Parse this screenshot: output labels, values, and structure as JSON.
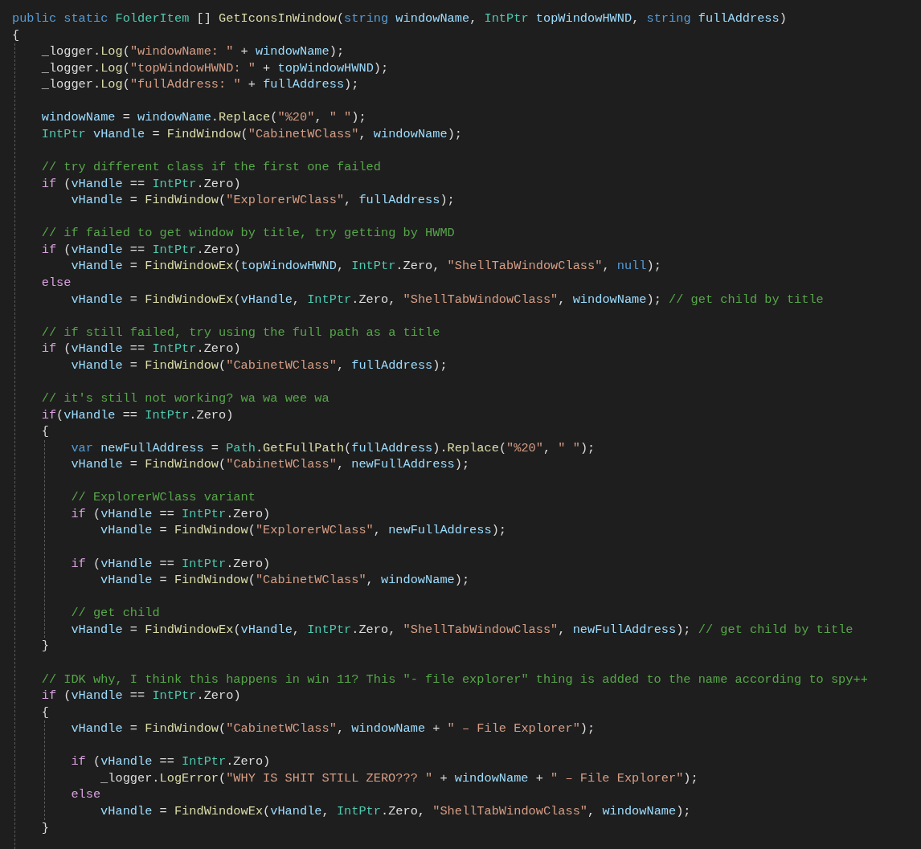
{
  "code": [
    {
      "kind": "line",
      "tokens": [
        {
          "kind": "kw",
          "text": "public static "
        },
        {
          "kind": "type",
          "text": "FolderItem"
        },
        {
          "kind": "p",
          "text": " [] "
        },
        {
          "kind": "fn",
          "text": "GetIconsInWindow"
        },
        {
          "kind": "p",
          "text": "("
        },
        {
          "kind": "kw",
          "text": "string "
        },
        {
          "kind": "var",
          "text": "windowName"
        },
        {
          "kind": "p",
          "text": ", "
        },
        {
          "kind": "type",
          "text": "IntPtr "
        },
        {
          "kind": "var",
          "text": "topWindowHWND"
        },
        {
          "kind": "p",
          "text": ", "
        },
        {
          "kind": "kw",
          "text": "string "
        },
        {
          "kind": "var",
          "text": "fullAddress"
        },
        {
          "kind": "p",
          "text": ")"
        }
      ]
    },
    {
      "kind": "line",
      "tokens": [
        {
          "kind": "p",
          "text": "{"
        }
      ]
    },
    {
      "kind": "block",
      "children": [
        {
          "kind": "line",
          "tokens": [
            {
              "kind": "p",
              "text": "_logger."
            },
            {
              "kind": "fn",
              "text": "Log"
            },
            {
              "kind": "p",
              "text": "("
            },
            {
              "kind": "str",
              "text": "\"windowName: \""
            },
            {
              "kind": "p",
              "text": " + "
            },
            {
              "kind": "var",
              "text": "windowName"
            },
            {
              "kind": "p",
              "text": ");"
            }
          ]
        },
        {
          "kind": "line",
          "tokens": [
            {
              "kind": "p",
              "text": "_logger."
            },
            {
              "kind": "fn",
              "text": "Log"
            },
            {
              "kind": "p",
              "text": "("
            },
            {
              "kind": "str",
              "text": "\"topWindowHWND: \""
            },
            {
              "kind": "p",
              "text": " + "
            },
            {
              "kind": "var",
              "text": "topWindowHWND"
            },
            {
              "kind": "p",
              "text": ");"
            }
          ]
        },
        {
          "kind": "line",
          "tokens": [
            {
              "kind": "p",
              "text": "_logger."
            },
            {
              "kind": "fn",
              "text": "Log"
            },
            {
              "kind": "p",
              "text": "("
            },
            {
              "kind": "str",
              "text": "\"fullAddress: \""
            },
            {
              "kind": "p",
              "text": " + "
            },
            {
              "kind": "var",
              "text": "fullAddress"
            },
            {
              "kind": "p",
              "text": ");"
            }
          ]
        },
        {
          "kind": "blank"
        },
        {
          "kind": "line",
          "tokens": [
            {
              "kind": "var",
              "text": "windowName"
            },
            {
              "kind": "p",
              "text": " = "
            },
            {
              "kind": "var",
              "text": "windowName"
            },
            {
              "kind": "p",
              "text": "."
            },
            {
              "kind": "fn",
              "text": "Replace"
            },
            {
              "kind": "p",
              "text": "("
            },
            {
              "kind": "str",
              "text": "\"%20\""
            },
            {
              "kind": "p",
              "text": ", "
            },
            {
              "kind": "str",
              "text": "\" \""
            },
            {
              "kind": "p",
              "text": ");"
            }
          ]
        },
        {
          "kind": "line",
          "tokens": [
            {
              "kind": "type",
              "text": "IntPtr "
            },
            {
              "kind": "var",
              "text": "vHandle"
            },
            {
              "kind": "p",
              "text": " = "
            },
            {
              "kind": "fn",
              "text": "FindWindow"
            },
            {
              "kind": "p",
              "text": "("
            },
            {
              "kind": "str",
              "text": "\"CabinetWClass\""
            },
            {
              "kind": "p",
              "text": ", "
            },
            {
              "kind": "var",
              "text": "windowName"
            },
            {
              "kind": "p",
              "text": ");"
            }
          ]
        },
        {
          "kind": "blank"
        },
        {
          "kind": "line",
          "tokens": [
            {
              "kind": "cm",
              "text": "// try different class if the first one failed"
            }
          ]
        },
        {
          "kind": "line",
          "tokens": [
            {
              "kind": "ctl",
              "text": "if"
            },
            {
              "kind": "p",
              "text": " ("
            },
            {
              "kind": "var",
              "text": "vHandle"
            },
            {
              "kind": "p",
              "text": " == "
            },
            {
              "kind": "type",
              "text": "IntPtr"
            },
            {
              "kind": "p",
              "text": ".Zero)"
            }
          ],
          "children": [
            {
              "kind": "line",
              "tokens": [
                {
                  "kind": "var",
                  "text": "vHandle"
                },
                {
                  "kind": "p",
                  "text": " = "
                },
                {
                  "kind": "fn",
                  "text": "FindWindow"
                },
                {
                  "kind": "p",
                  "text": "("
                },
                {
                  "kind": "str",
                  "text": "\"ExplorerWClass\""
                },
                {
                  "kind": "p",
                  "text": ", "
                },
                {
                  "kind": "var",
                  "text": "fullAddress"
                },
                {
                  "kind": "p",
                  "text": ");"
                }
              ]
            }
          ]
        },
        {
          "kind": "blank"
        },
        {
          "kind": "line",
          "tokens": [
            {
              "kind": "cm",
              "text": "// if failed to get window by title, try getting by HWMD"
            }
          ]
        },
        {
          "kind": "line",
          "tokens": [
            {
              "kind": "ctl",
              "text": "if"
            },
            {
              "kind": "p",
              "text": " ("
            },
            {
              "kind": "var",
              "text": "vHandle"
            },
            {
              "kind": "p",
              "text": " == "
            },
            {
              "kind": "type",
              "text": "IntPtr"
            },
            {
              "kind": "p",
              "text": ".Zero)"
            }
          ],
          "children": [
            {
              "kind": "line",
              "tokens": [
                {
                  "kind": "var",
                  "text": "vHandle"
                },
                {
                  "kind": "p",
                  "text": " = "
                },
                {
                  "kind": "fn",
                  "text": "FindWindowEx"
                },
                {
                  "kind": "p",
                  "text": "("
                },
                {
                  "kind": "var",
                  "text": "topWindowHWND"
                },
                {
                  "kind": "p",
                  "text": ", "
                },
                {
                  "kind": "type",
                  "text": "IntPtr"
                },
                {
                  "kind": "p",
                  "text": ".Zero, "
                },
                {
                  "kind": "str",
                  "text": "\"ShellTabWindowClass\""
                },
                {
                  "kind": "p",
                  "text": ", "
                },
                {
                  "kind": "kw",
                  "text": "null"
                },
                {
                  "kind": "p",
                  "text": ");"
                }
              ]
            }
          ]
        },
        {
          "kind": "line",
          "tokens": [
            {
              "kind": "ctl",
              "text": "else"
            }
          ],
          "children": [
            {
              "kind": "line",
              "tokens": [
                {
                  "kind": "var",
                  "text": "vHandle"
                },
                {
                  "kind": "p",
                  "text": " = "
                },
                {
                  "kind": "fn",
                  "text": "FindWindowEx"
                },
                {
                  "kind": "p",
                  "text": "("
                },
                {
                  "kind": "var",
                  "text": "vHandle"
                },
                {
                  "kind": "p",
                  "text": ", "
                },
                {
                  "kind": "type",
                  "text": "IntPtr"
                },
                {
                  "kind": "p",
                  "text": ".Zero, "
                },
                {
                  "kind": "str",
                  "text": "\"ShellTabWindowClass\""
                },
                {
                  "kind": "p",
                  "text": ", "
                },
                {
                  "kind": "var",
                  "text": "windowName"
                },
                {
                  "kind": "p",
                  "text": "); "
                },
                {
                  "kind": "cm",
                  "text": "// get child by title"
                }
              ]
            }
          ]
        },
        {
          "kind": "blank"
        },
        {
          "kind": "line",
          "tokens": [
            {
              "kind": "cm",
              "text": "// if still failed, try using the full path as a title"
            }
          ]
        },
        {
          "kind": "line",
          "tokens": [
            {
              "kind": "ctl",
              "text": "if"
            },
            {
              "kind": "p",
              "text": " ("
            },
            {
              "kind": "var",
              "text": "vHandle"
            },
            {
              "kind": "p",
              "text": " == "
            },
            {
              "kind": "type",
              "text": "IntPtr"
            },
            {
              "kind": "p",
              "text": ".Zero)"
            }
          ],
          "children": [
            {
              "kind": "line",
              "tokens": [
                {
                  "kind": "var",
                  "text": "vHandle"
                },
                {
                  "kind": "p",
                  "text": " = "
                },
                {
                  "kind": "fn",
                  "text": "FindWindow"
                },
                {
                  "kind": "p",
                  "text": "("
                },
                {
                  "kind": "str",
                  "text": "\"CabinetWClass\""
                },
                {
                  "kind": "p",
                  "text": ", "
                },
                {
                  "kind": "var",
                  "text": "fullAddress"
                },
                {
                  "kind": "p",
                  "text": ");"
                }
              ]
            }
          ]
        },
        {
          "kind": "blank"
        },
        {
          "kind": "line",
          "tokens": [
            {
              "kind": "cm",
              "text": "// it's still not working? wa wa wee wa"
            }
          ]
        },
        {
          "kind": "line",
          "tokens": [
            {
              "kind": "ctl",
              "text": "if"
            },
            {
              "kind": "p",
              "text": "("
            },
            {
              "kind": "var",
              "text": "vHandle"
            },
            {
              "kind": "p",
              "text": " == "
            },
            {
              "kind": "type",
              "text": "IntPtr"
            },
            {
              "kind": "p",
              "text": ".Zero)"
            }
          ]
        },
        {
          "kind": "line",
          "tokens": [
            {
              "kind": "p",
              "text": "{"
            }
          ]
        },
        {
          "kind": "block",
          "children": [
            {
              "kind": "line",
              "tokens": [
                {
                  "kind": "kw",
                  "text": "var "
                },
                {
                  "kind": "var",
                  "text": "newFullAddress"
                },
                {
                  "kind": "p",
                  "text": " = "
                },
                {
                  "kind": "type",
                  "text": "Path"
                },
                {
                  "kind": "p",
                  "text": "."
                },
                {
                  "kind": "fn",
                  "text": "GetFullPath"
                },
                {
                  "kind": "p",
                  "text": "("
                },
                {
                  "kind": "var",
                  "text": "fullAddress"
                },
                {
                  "kind": "p",
                  "text": ")."
                },
                {
                  "kind": "fn",
                  "text": "Replace"
                },
                {
                  "kind": "p",
                  "text": "("
                },
                {
                  "kind": "str",
                  "text": "\"%20\""
                },
                {
                  "kind": "p",
                  "text": ", "
                },
                {
                  "kind": "str",
                  "text": "\" \""
                },
                {
                  "kind": "p",
                  "text": ");"
                }
              ]
            },
            {
              "kind": "line",
              "tokens": [
                {
                  "kind": "var",
                  "text": "vHandle"
                },
                {
                  "kind": "p",
                  "text": " = "
                },
                {
                  "kind": "fn",
                  "text": "FindWindow"
                },
                {
                  "kind": "p",
                  "text": "("
                },
                {
                  "kind": "str",
                  "text": "\"CabinetWClass\""
                },
                {
                  "kind": "p",
                  "text": ", "
                },
                {
                  "kind": "var",
                  "text": "newFullAddress"
                },
                {
                  "kind": "p",
                  "text": ");"
                }
              ]
            },
            {
              "kind": "blank"
            },
            {
              "kind": "line",
              "tokens": [
                {
                  "kind": "cm",
                  "text": "// ExplorerWClass variant"
                }
              ]
            },
            {
              "kind": "line",
              "tokens": [
                {
                  "kind": "ctl",
                  "text": "if"
                },
                {
                  "kind": "p",
                  "text": " ("
                },
                {
                  "kind": "var",
                  "text": "vHandle"
                },
                {
                  "kind": "p",
                  "text": " == "
                },
                {
                  "kind": "type",
                  "text": "IntPtr"
                },
                {
                  "kind": "p",
                  "text": ".Zero)"
                }
              ],
              "children": [
                {
                  "kind": "line",
                  "tokens": [
                    {
                      "kind": "var",
                      "text": "vHandle"
                    },
                    {
                      "kind": "p",
                      "text": " = "
                    },
                    {
                      "kind": "fn",
                      "text": "FindWindow"
                    },
                    {
                      "kind": "p",
                      "text": "("
                    },
                    {
                      "kind": "str",
                      "text": "\"ExplorerWClass\""
                    },
                    {
                      "kind": "p",
                      "text": ", "
                    },
                    {
                      "kind": "var",
                      "text": "newFullAddress"
                    },
                    {
                      "kind": "p",
                      "text": ");"
                    }
                  ]
                }
              ]
            },
            {
              "kind": "blank"
            },
            {
              "kind": "line",
              "tokens": [
                {
                  "kind": "ctl",
                  "text": "if"
                },
                {
                  "kind": "p",
                  "text": " ("
                },
                {
                  "kind": "var",
                  "text": "vHandle"
                },
                {
                  "kind": "p",
                  "text": " == "
                },
                {
                  "kind": "type",
                  "text": "IntPtr"
                },
                {
                  "kind": "p",
                  "text": ".Zero)"
                }
              ],
              "children": [
                {
                  "kind": "line",
                  "tokens": [
                    {
                      "kind": "var",
                      "text": "vHandle"
                    },
                    {
                      "kind": "p",
                      "text": " = "
                    },
                    {
                      "kind": "fn",
                      "text": "FindWindow"
                    },
                    {
                      "kind": "p",
                      "text": "("
                    },
                    {
                      "kind": "str",
                      "text": "\"CabinetWClass\""
                    },
                    {
                      "kind": "p",
                      "text": ", "
                    },
                    {
                      "kind": "var",
                      "text": "windowName"
                    },
                    {
                      "kind": "p",
                      "text": ");"
                    }
                  ]
                }
              ]
            },
            {
              "kind": "blank"
            },
            {
              "kind": "line",
              "tokens": [
                {
                  "kind": "cm",
                  "text": "// get child"
                }
              ]
            },
            {
              "kind": "line",
              "tokens": [
                {
                  "kind": "var",
                  "text": "vHandle"
                },
                {
                  "kind": "p",
                  "text": " = "
                },
                {
                  "kind": "fn",
                  "text": "FindWindowEx"
                },
                {
                  "kind": "p",
                  "text": "("
                },
                {
                  "kind": "var",
                  "text": "vHandle"
                },
                {
                  "kind": "p",
                  "text": ", "
                },
                {
                  "kind": "type",
                  "text": "IntPtr"
                },
                {
                  "kind": "p",
                  "text": ".Zero, "
                },
                {
                  "kind": "str",
                  "text": "\"ShellTabWindowClass\""
                },
                {
                  "kind": "p",
                  "text": ", "
                },
                {
                  "kind": "var",
                  "text": "newFullAddress"
                },
                {
                  "kind": "p",
                  "text": "); "
                },
                {
                  "kind": "cm",
                  "text": "// get child by title"
                }
              ]
            }
          ]
        },
        {
          "kind": "line",
          "tokens": [
            {
              "kind": "p",
              "text": "}"
            }
          ]
        },
        {
          "kind": "blank"
        },
        {
          "kind": "line",
          "tokens": [
            {
              "kind": "cm",
              "text": "// IDK why, I think this happens in win 11? This \"- file explorer\" thing is added to the name according to spy++"
            }
          ]
        },
        {
          "kind": "line",
          "tokens": [
            {
              "kind": "ctl",
              "text": "if"
            },
            {
              "kind": "p",
              "text": " ("
            },
            {
              "kind": "var",
              "text": "vHandle"
            },
            {
              "kind": "p",
              "text": " == "
            },
            {
              "kind": "type",
              "text": "IntPtr"
            },
            {
              "kind": "p",
              "text": ".Zero)"
            }
          ]
        },
        {
          "kind": "line",
          "tokens": [
            {
              "kind": "p",
              "text": "{"
            }
          ]
        },
        {
          "kind": "block",
          "children": [
            {
              "kind": "line",
              "tokens": [
                {
                  "kind": "var",
                  "text": "vHandle"
                },
                {
                  "kind": "p",
                  "text": " = "
                },
                {
                  "kind": "fn",
                  "text": "FindWindow"
                },
                {
                  "kind": "p",
                  "text": "("
                },
                {
                  "kind": "str",
                  "text": "\"CabinetWClass\""
                },
                {
                  "kind": "p",
                  "text": ", "
                },
                {
                  "kind": "var",
                  "text": "windowName"
                },
                {
                  "kind": "p",
                  "text": " + "
                },
                {
                  "kind": "str",
                  "text": "\" – File Explorer\""
                },
                {
                  "kind": "p",
                  "text": ");"
                }
              ]
            },
            {
              "kind": "blank"
            },
            {
              "kind": "line",
              "tokens": [
                {
                  "kind": "ctl",
                  "text": "if"
                },
                {
                  "kind": "p",
                  "text": " ("
                },
                {
                  "kind": "var",
                  "text": "vHandle"
                },
                {
                  "kind": "p",
                  "text": " == "
                },
                {
                  "kind": "type",
                  "text": "IntPtr"
                },
                {
                  "kind": "p",
                  "text": ".Zero)"
                }
              ],
              "children": [
                {
                  "kind": "line",
                  "tokens": [
                    {
                      "kind": "p",
                      "text": "_logger."
                    },
                    {
                      "kind": "fn",
                      "text": "LogError"
                    },
                    {
                      "kind": "p",
                      "text": "("
                    },
                    {
                      "kind": "str",
                      "text": "\"WHY IS SHIT STILL ZERO??? \""
                    },
                    {
                      "kind": "p",
                      "text": " + "
                    },
                    {
                      "kind": "var",
                      "text": "windowName"
                    },
                    {
                      "kind": "p",
                      "text": " + "
                    },
                    {
                      "kind": "str",
                      "text": "\" – File Explorer\""
                    },
                    {
                      "kind": "p",
                      "text": ");"
                    }
                  ]
                }
              ]
            },
            {
              "kind": "line",
              "tokens": [
                {
                  "kind": "ctl",
                  "text": "else"
                }
              ],
              "children": [
                {
                  "kind": "line",
                  "tokens": [
                    {
                      "kind": "var",
                      "text": "vHandle"
                    },
                    {
                      "kind": "p",
                      "text": " = "
                    },
                    {
                      "kind": "fn",
                      "text": "FindWindowEx"
                    },
                    {
                      "kind": "p",
                      "text": "("
                    },
                    {
                      "kind": "var",
                      "text": "vHandle"
                    },
                    {
                      "kind": "p",
                      "text": ", "
                    },
                    {
                      "kind": "type",
                      "text": "IntPtr"
                    },
                    {
                      "kind": "p",
                      "text": ".Zero, "
                    },
                    {
                      "kind": "str",
                      "text": "\"ShellTabWindowClass\""
                    },
                    {
                      "kind": "p",
                      "text": ", "
                    },
                    {
                      "kind": "var",
                      "text": "windowName"
                    },
                    {
                      "kind": "p",
                      "text": ");"
                    }
                  ]
                }
              ]
            }
          ]
        },
        {
          "kind": "line",
          "tokens": [
            {
              "kind": "p",
              "text": "}"
            }
          ]
        },
        {
          "kind": "blank"
        }
      ]
    }
  ]
}
